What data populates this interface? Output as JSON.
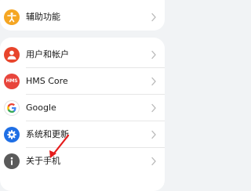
{
  "settings_top": {
    "items": [
      {
        "label": "辅助功能",
        "icon": "accessibility-icon",
        "color": "#f5a623"
      }
    ]
  },
  "settings_main": {
    "items": [
      {
        "label": "用户和帐户",
        "icon": "user-icon",
        "color": "#e8452c"
      },
      {
        "label": "HMS Core",
        "icon": "hms-logo-icon",
        "badge": "HMS",
        "color": "#e8453c"
      },
      {
        "label": "Google",
        "icon": "google-icon",
        "color": "#ffffff"
      },
      {
        "label": "系统和更新",
        "icon": "gear-icon",
        "color": "#1f6fe5"
      },
      {
        "label": "关于手机",
        "icon": "info-icon",
        "color": "#5a5a5a"
      }
    ]
  },
  "annotation": {
    "color": "#e51c1c",
    "icon": "red-arrow-icon"
  }
}
